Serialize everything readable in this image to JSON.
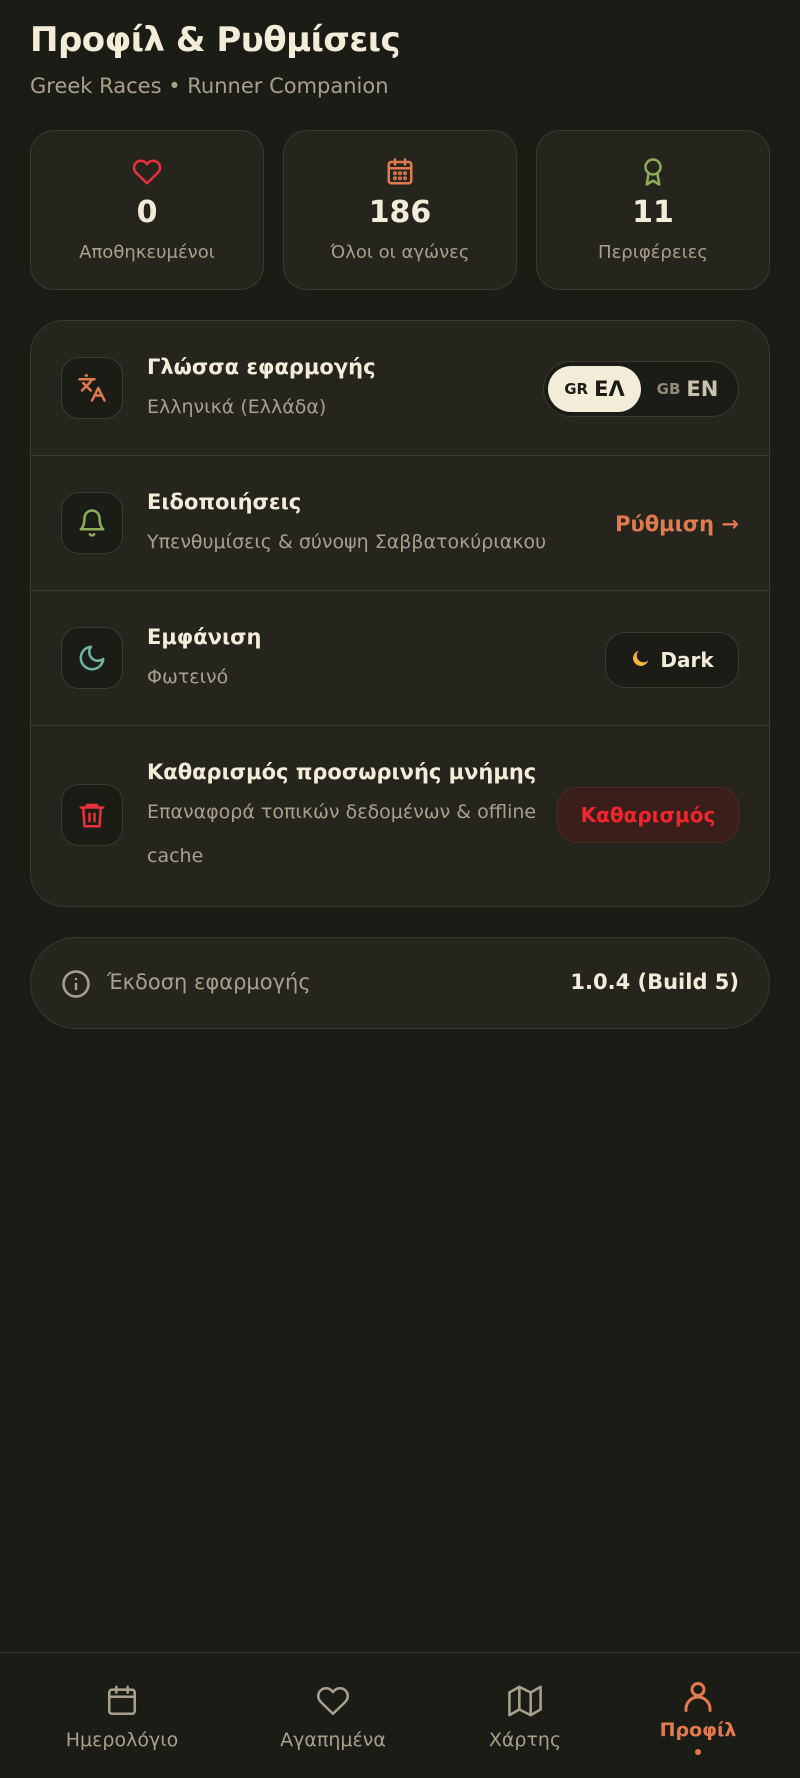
{
  "header": {
    "title": "Προφίλ & Ρυθμίσεις",
    "subtitle": "Greek Races • Runner Companion"
  },
  "stats": [
    {
      "icon": "heart-icon",
      "value": "0",
      "label": "Αποθηκευμένοι",
      "color": "#e8313a"
    },
    {
      "icon": "calendar-icon",
      "value": "186",
      "label": "Όλοι οι αγώνες",
      "color": "#e17a4e"
    },
    {
      "icon": "award-icon",
      "value": "11",
      "label": "Περιφέρειες",
      "color": "#8fae5c"
    }
  ],
  "settings": {
    "language": {
      "title": "Γλώσσα εφαρμογής",
      "desc": "Ελληνικά (Ελλάδα)",
      "options": [
        {
          "code": "GR",
          "name": "ΕΛ",
          "active": true
        },
        {
          "code": "GB",
          "name": "EN",
          "active": false
        }
      ]
    },
    "notifications": {
      "title": "Ειδοποιήσεις",
      "desc": "Υπενθυμίσεις & σύνοψη Σαββατοκύριακου",
      "action": "Ρύθμιση →"
    },
    "appearance": {
      "title": "Εμφάνιση",
      "desc": "Φωτεινό",
      "button": "Dark"
    },
    "cache": {
      "title": "Καθαρισμός προσωρινής μνήμης",
      "desc_line1": "Επαναφορά τοπικών δεδομένων & offline",
      "desc_line2": "cache",
      "button": "Καθαρισμός"
    }
  },
  "version": {
    "label": "Έκδοση εφαρμογής",
    "value": "1.0.4 (Build 5)"
  },
  "tabs": [
    {
      "icon": "calendar-icon",
      "label": "Ημερολόγιο",
      "active": false
    },
    {
      "icon": "heart-icon",
      "label": "Αγαπημένα",
      "active": false
    },
    {
      "icon": "map-icon",
      "label": "Χάρτης",
      "active": false
    },
    {
      "icon": "user-icon",
      "label": "Προφίλ",
      "active": true
    }
  ],
  "colors": {
    "background": "#1c1c16",
    "card": "#25251e",
    "accent": "#e17a4e",
    "danger": "#f0252d",
    "text": "#f3ecd8",
    "muted": "#a8a08c"
  }
}
